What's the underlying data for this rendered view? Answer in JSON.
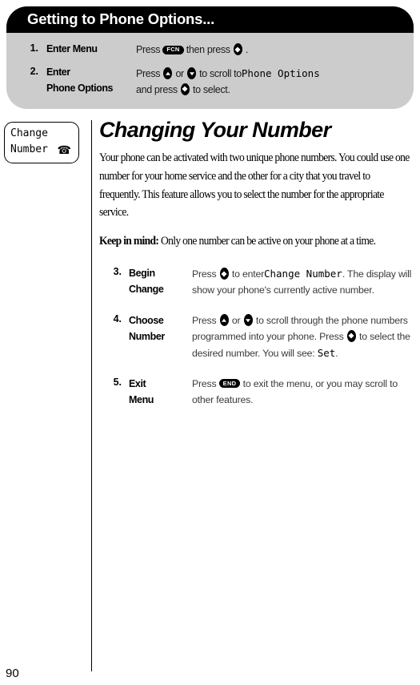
{
  "callout": {
    "title": "Getting to Phone Options...",
    "steps": [
      {
        "number": "1.",
        "label": "Enter Menu",
        "text_before": "Press",
        "key1": "FCN",
        "text_mid": "then press",
        "text_after": "."
      },
      {
        "number": "2.",
        "label_line1": "Enter",
        "label_line2": "Phone Options",
        "line1_before": "Press",
        "line1_mid": "or",
        "line1_after": "to scroll to",
        "line1_display": "Phone Options",
        "line2_before": "and press",
        "line2_after": "to select."
      }
    ]
  },
  "side_tab": {
    "line1": "Change",
    "line2": "Number",
    "icon": "phone-icon",
    "icon_glyph": "☎"
  },
  "main": {
    "heading": "Changing Your Number",
    "paragraph1": "Your phone can be activated with two unique phone numbers. You could use one number for your home service and the other for a city that you travel to frequently. This feature allows you to select the number for the appropriate service.",
    "keep_in_mind_label": "Keep in mind:",
    "keep_in_mind_text": " Only one number can be active on your phone at a time."
  },
  "steps": [
    {
      "number": "3.",
      "label_line1": "Begin",
      "label_line2": "Change",
      "t1": "Press",
      "t2": "to enter",
      "display": "Change Number",
      "t3": ". The display will show your phone's currently active number."
    },
    {
      "number": "4.",
      "label_line1": "Choose",
      "label_line2": "Number",
      "t1": "Press",
      "t2": "or",
      "t3": "to scroll through the phone numbers programmed into your phone. Press",
      "t4": "to select the desired number. You will see:",
      "display": "Set",
      "t5": "."
    },
    {
      "number": "5.",
      "label_line1": "Exit",
      "label_line2": "Menu",
      "t1": "Press",
      "key": "END",
      "t2": "to exit the menu, or you may scroll to other features."
    }
  ],
  "footer": {
    "page_number": "90"
  },
  "colors": {
    "title_bar": "#000000",
    "callout_body": "#cccccc",
    "text": "#000000",
    "step_text": "#3a3a3a"
  }
}
